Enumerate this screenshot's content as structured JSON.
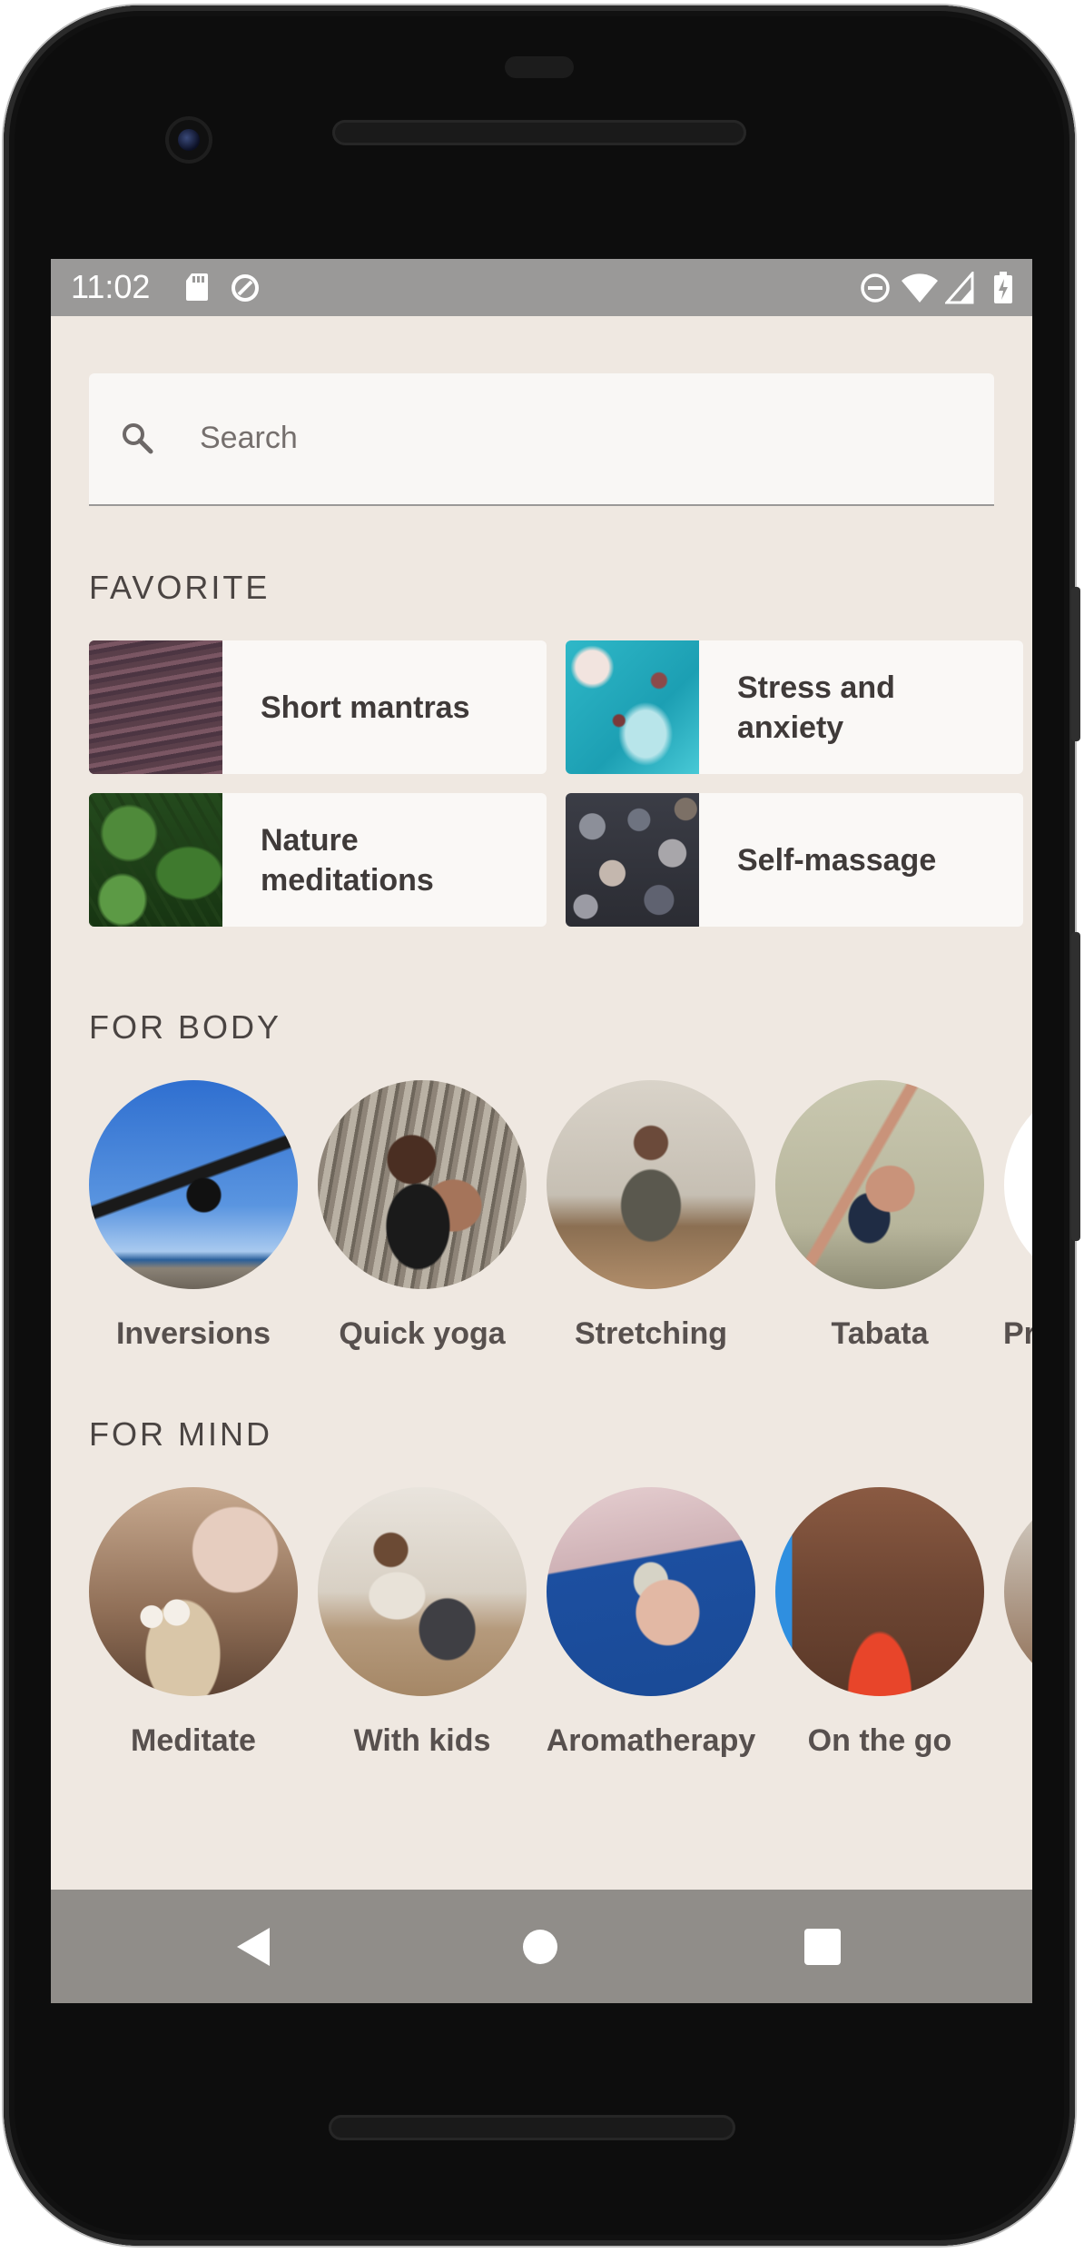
{
  "status_bar": {
    "time": "11:02",
    "left_icons": [
      "sd-card-icon",
      "data-saver-icon"
    ],
    "right_icons": [
      "do-not-disturb-icon",
      "wifi-icon",
      "cellular-signal-icon",
      "battery-charging-icon"
    ]
  },
  "search": {
    "placeholder": "Search",
    "icon": "search-icon"
  },
  "favorite": {
    "title": "FAVORITE",
    "items": [
      {
        "label": "Short mantras",
        "image": "sea-water-image"
      },
      {
        "label": "Stress and anxiety",
        "image": "turquoise-water-image"
      },
      {
        "label": "Nature meditations",
        "image": "monstera-leaves-image"
      },
      {
        "label": "Self-massage",
        "image": "pebbles-image"
      }
    ]
  },
  "for_body": {
    "title": "FOR BODY",
    "items": [
      {
        "label": "Inversions",
        "image": "yoga-inversion-image"
      },
      {
        "label": "Quick yoga",
        "image": "quick-yoga-image"
      },
      {
        "label": "Stretching",
        "image": "stretching-image"
      },
      {
        "label": "Tabata",
        "image": "tabata-image"
      },
      {
        "label": "Pr",
        "image": "partial-image"
      }
    ]
  },
  "for_mind": {
    "title": "FOR MIND",
    "items": [
      {
        "label": "Meditate",
        "image": "candles-meditation-image"
      },
      {
        "label": "With kids",
        "image": "yoga-with-kids-image"
      },
      {
        "label": "Aromatherapy",
        "image": "sage-bundle-image"
      },
      {
        "label": "On the go",
        "image": "red-rock-image"
      },
      {
        "label": "",
        "image": "partial-image"
      }
    ]
  },
  "nav_bar": {
    "buttons": [
      "back-icon",
      "home-icon",
      "recents-icon"
    ]
  },
  "colors": {
    "screen_bg": "#efe8e1",
    "card_bg": "#faf8f6",
    "status_bar": "#9a9998",
    "nav_bar": "#908d89",
    "text_dark": "#3f3a39"
  }
}
